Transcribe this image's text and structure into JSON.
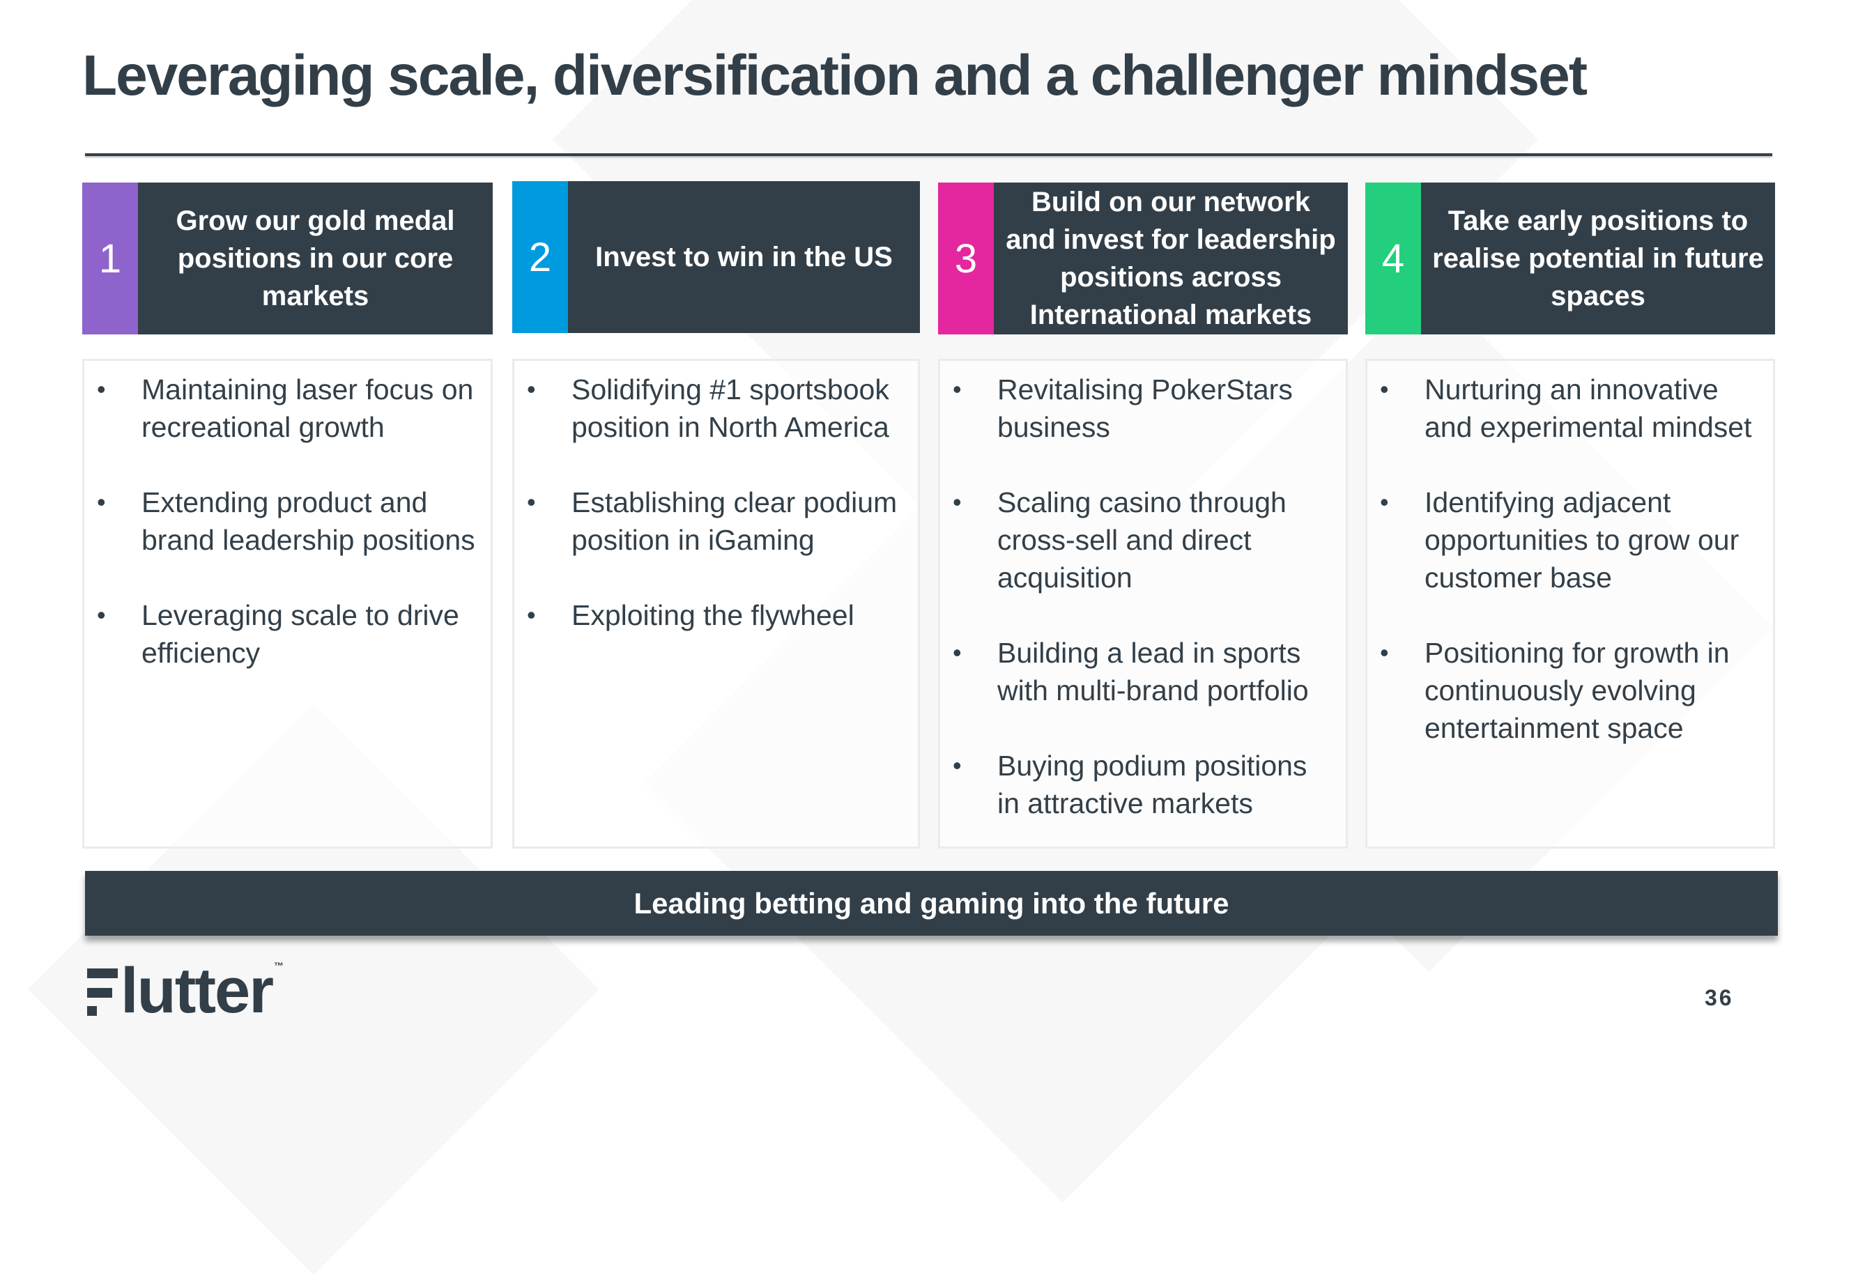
{
  "title": "Leveraging scale, diversification and a challenger mindset",
  "colors": {
    "dark": "#333f48",
    "purple": "#8e63cc",
    "blue": "#009ade",
    "magenta": "#e4279f",
    "green": "#23cf7c"
  },
  "columns": [
    {
      "number": "1",
      "accent": "#8e63cc",
      "heading": "Grow our gold medal positions in our core markets",
      "bullets": [
        "Maintaining laser focus on recreational growth",
        "Extending product and brand leadership positions",
        "Leveraging scale to drive efficiency"
      ]
    },
    {
      "number": "2",
      "accent": "#009ade",
      "heading": "Invest to win in the US",
      "bullets": [
        "Solidifying #1 sportsbook position in North America",
        "Establishing clear podium position in iGaming",
        "Exploiting the flywheel"
      ]
    },
    {
      "number": "3",
      "accent": "#e4279f",
      "heading": "Build on our network and invest for leadership positions across International markets",
      "bullets": [
        "Revitalising PokerStars business",
        "Scaling casino through cross-sell and direct acquisition",
        "Building a lead in sports with multi-brand portfolio",
        "Buying podium positions in attractive markets"
      ]
    },
    {
      "number": "4",
      "accent": "#23cf7c",
      "heading": "Take early positions to realise potential in future spaces",
      "bullets": [
        "Nurturing an innovative and experimental mindset",
        "Identifying adjacent opportunities to grow our customer base",
        "Positioning for growth in continuously evolving entertainment space"
      ]
    }
  ],
  "footer_banner": "Leading betting and gaming into the future",
  "logo": {
    "text": "lutter",
    "tm": "™",
    "icon": "flutter-f-logo-icon"
  },
  "page_number": "36",
  "bullet_glyph": "•"
}
